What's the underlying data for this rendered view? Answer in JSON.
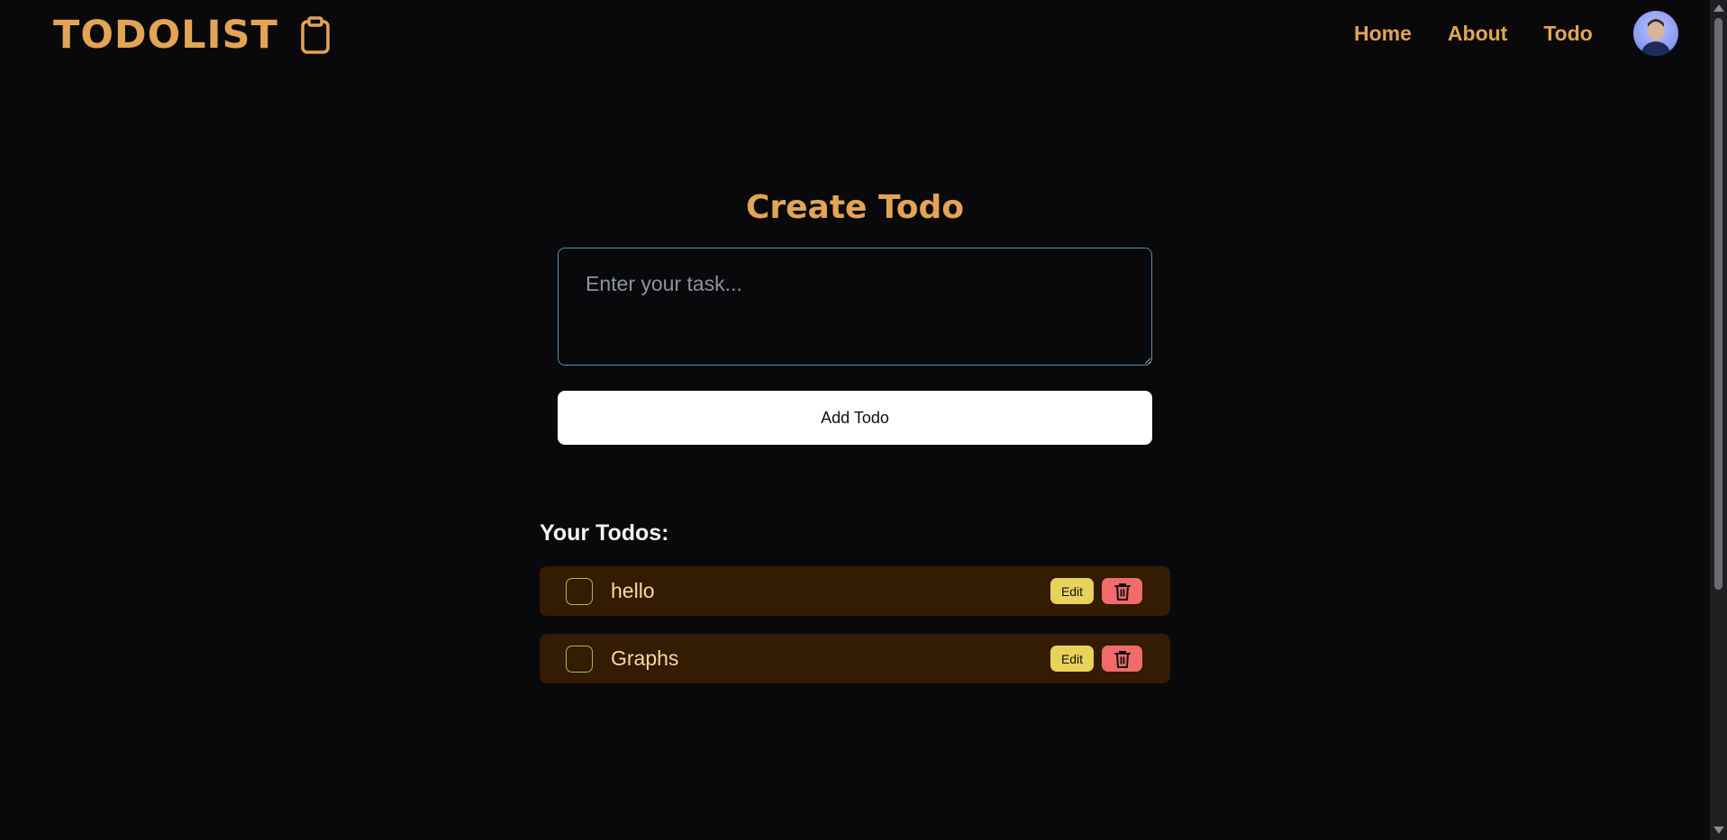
{
  "colors": {
    "background": "#09090b",
    "accent": "#e3a455",
    "todo_row": "#341b04",
    "todo_text": "#f6d9a4",
    "edit_button": "#e7d35a",
    "delete_button": "#f16b6b",
    "input_border": "#5b8fb0"
  },
  "navbar": {
    "brand": "TODOLIST",
    "brand_icon": "clipboard-icon",
    "links": [
      {
        "label": "Home"
      },
      {
        "label": "About"
      },
      {
        "label": "Todo"
      }
    ],
    "avatar_icon": "user-avatar"
  },
  "create": {
    "title": "Create Todo",
    "input_placeholder": "Enter your task...",
    "input_value": "",
    "add_button_label": "Add Todo"
  },
  "todos": {
    "heading": "Your Todos:",
    "items": [
      {
        "text": "hello",
        "completed": false,
        "edit_label": "Edit",
        "delete_icon": "trash-icon"
      },
      {
        "text": "Graphs",
        "completed": false,
        "edit_label": "Edit",
        "delete_icon": "trash-icon"
      }
    ]
  }
}
